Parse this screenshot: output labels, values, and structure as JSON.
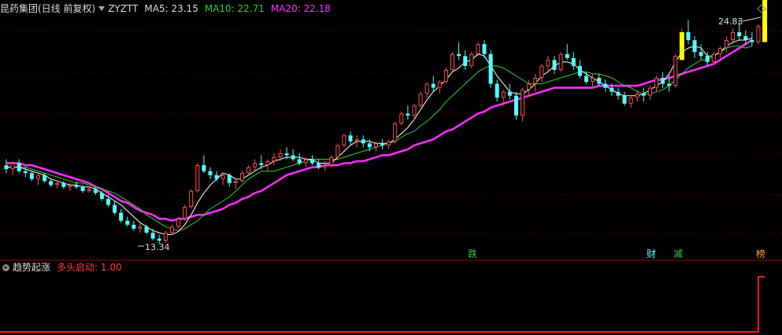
{
  "header": {
    "stock_name": "昆药集团(日线 前复权)",
    "indicator_name": "ZYZTT",
    "ma5_label": "MA5: 23.15",
    "ma10_label": "MA10: 22.71",
    "ma20_label": "MA20: 22.18"
  },
  "sub_header": {
    "indicator_name": "趋势起涨",
    "signal_label": "多头启动: 1.00"
  },
  "markers": {
    "high_label": "24.83",
    "low_label": "13.34",
    "signal_die": "跌",
    "signal_cai": "财",
    "signal_jian": "减",
    "signal_bang": "榜"
  },
  "colors": {
    "up": "#ff4d4d",
    "down": "#54ffff",
    "ma5": "#ffffff",
    "ma10": "#30d030",
    "ma20": "#ff2bff",
    "signal_bar": "#ffff00",
    "grid": "#7a0000",
    "signal_line": "#ff1a1a"
  },
  "chart_data": [
    {
      "type": "candlestick",
      "title": "昆药集团(日线 前复权)",
      "ohlc": [
        [
          17.3,
          17.6,
          16.9,
          17.1
        ],
        [
          17.1,
          17.5,
          16.8,
          17.4
        ],
        [
          17.4,
          17.6,
          16.9,
          17.0
        ],
        [
          17.0,
          17.2,
          16.7,
          16.9
        ],
        [
          16.9,
          17.0,
          16.5,
          16.6
        ],
        [
          16.6,
          16.9,
          16.3,
          16.8
        ],
        [
          16.8,
          16.9,
          16.4,
          16.5
        ],
        [
          16.5,
          16.6,
          16.2,
          16.3
        ],
        [
          16.3,
          16.5,
          16.1,
          16.4
        ],
        [
          16.4,
          16.5,
          16.1,
          16.2
        ],
        [
          16.2,
          16.4,
          16.0,
          16.3
        ],
        [
          16.3,
          16.5,
          16.1,
          16.2
        ],
        [
          16.2,
          16.3,
          15.9,
          16.0
        ],
        [
          16.0,
          16.2,
          15.9,
          16.1
        ],
        [
          16.1,
          16.2,
          15.8,
          15.9
        ],
        [
          15.9,
          16.0,
          15.5,
          15.6
        ],
        [
          15.6,
          15.8,
          15.2,
          15.3
        ],
        [
          15.3,
          15.5,
          14.8,
          14.9
        ],
        [
          14.9,
          15.1,
          14.4,
          14.5
        ],
        [
          14.5,
          14.7,
          14.2,
          14.3
        ],
        [
          14.3,
          14.5,
          14.0,
          14.1
        ],
        [
          14.1,
          14.4,
          13.9,
          14.2
        ],
        [
          14.2,
          14.3,
          13.8,
          13.9
        ],
        [
          13.9,
          14.1,
          13.5,
          13.6
        ],
        [
          13.6,
          13.8,
          13.34,
          13.5
        ],
        [
          13.5,
          14.0,
          13.4,
          13.9
        ],
        [
          13.9,
          14.3,
          13.8,
          14.2
        ],
        [
          14.2,
          14.7,
          14.1,
          14.6
        ],
        [
          14.6,
          15.3,
          14.5,
          15.2
        ],
        [
          15.2,
          16.1,
          15.1,
          16.0
        ],
        [
          16.0,
          17.4,
          15.9,
          17.3
        ],
        [
          17.3,
          17.8,
          16.9,
          17.0
        ],
        [
          17.0,
          17.2,
          16.6,
          16.8
        ],
        [
          16.8,
          17.0,
          16.5,
          16.6
        ],
        [
          16.6,
          16.9,
          16.3,
          16.8
        ],
        [
          16.8,
          16.9,
          16.2,
          16.4
        ],
        [
          16.4,
          16.6,
          16.1,
          16.5
        ],
        [
          16.5,
          17.0,
          16.4,
          16.9
        ],
        [
          16.9,
          17.3,
          16.8,
          17.2
        ],
        [
          17.2,
          17.6,
          17.0,
          17.4
        ],
        [
          17.4,
          17.8,
          17.1,
          17.3
        ],
        [
          17.3,
          17.6,
          17.0,
          17.5
        ],
        [
          17.5,
          17.9,
          17.3,
          17.7
        ],
        [
          17.7,
          18.1,
          17.5,
          17.9
        ],
        [
          17.9,
          18.2,
          17.6,
          17.8
        ],
        [
          17.8,
          18.1,
          17.5,
          17.6
        ],
        [
          17.6,
          17.9,
          17.3,
          17.4
        ],
        [
          17.4,
          17.7,
          17.2,
          17.6
        ],
        [
          17.6,
          17.8,
          17.3,
          17.4
        ],
        [
          17.4,
          17.6,
          17.1,
          17.2
        ],
        [
          17.2,
          17.5,
          17.0,
          17.3
        ],
        [
          17.3,
          17.8,
          17.2,
          17.7
        ],
        [
          17.7,
          18.4,
          17.6,
          18.3
        ],
        [
          18.3,
          18.9,
          18.2,
          18.8
        ],
        [
          18.8,
          19.0,
          18.3,
          18.5
        ],
        [
          18.5,
          18.8,
          18.2,
          18.6
        ],
        [
          18.6,
          18.8,
          18.2,
          18.4
        ],
        [
          18.4,
          18.6,
          18.0,
          18.2
        ],
        [
          18.2,
          18.5,
          18.0,
          18.4
        ],
        [
          18.4,
          18.6,
          18.1,
          18.3
        ],
        [
          18.3,
          18.6,
          18.1,
          18.5
        ],
        [
          18.5,
          19.5,
          18.4,
          19.4
        ],
        [
          19.4,
          20.0,
          19.3,
          19.9
        ],
        [
          19.9,
          20.3,
          19.6,
          19.8
        ],
        [
          19.8,
          20.4,
          19.6,
          20.3
        ],
        [
          20.3,
          21.0,
          20.2,
          20.9
        ],
        [
          20.9,
          21.5,
          20.7,
          21.4
        ],
        [
          21.4,
          21.8,
          21.0,
          21.2
        ],
        [
          21.2,
          21.6,
          20.9,
          21.5
        ],
        [
          21.5,
          22.2,
          21.4,
          22.1
        ],
        [
          22.1,
          23.0,
          22.0,
          22.9
        ],
        [
          22.9,
          23.5,
          22.6,
          22.8
        ],
        [
          22.8,
          23.1,
          22.1,
          22.3
        ],
        [
          22.3,
          23.0,
          22.2,
          22.9
        ],
        [
          22.9,
          23.5,
          22.8,
          23.4
        ],
        [
          23.4,
          23.6,
          22.7,
          22.9
        ],
        [
          22.9,
          23.1,
          21.2,
          21.4
        ],
        [
          21.4,
          21.6,
          20.5,
          20.7
        ],
        [
          20.7,
          21.1,
          20.3,
          21.0
        ],
        [
          21.0,
          21.4,
          20.6,
          20.8
        ],
        [
          20.8,
          21.0,
          19.6,
          19.8
        ],
        [
          19.8,
          21.2,
          19.5,
          21.1
        ],
        [
          21.1,
          21.6,
          20.8,
          21.4
        ],
        [
          21.4,
          21.9,
          21.0,
          21.7
        ],
        [
          21.7,
          22.4,
          21.5,
          22.3
        ],
        [
          22.3,
          22.8,
          22.0,
          22.6
        ],
        [
          22.6,
          22.8,
          21.9,
          22.1
        ],
        [
          22.1,
          23.0,
          22.0,
          22.9
        ],
        [
          22.9,
          23.4,
          22.6,
          22.7
        ],
        [
          22.7,
          23.0,
          22.1,
          22.3
        ],
        [
          22.3,
          22.6,
          21.7,
          21.8
        ],
        [
          21.8,
          22.0,
          21.4,
          21.5
        ],
        [
          21.5,
          21.9,
          21.2,
          21.7
        ],
        [
          21.7,
          21.9,
          21.3,
          21.4
        ],
        [
          21.4,
          21.6,
          21.0,
          21.2
        ],
        [
          21.2,
          21.4,
          20.8,
          21.0
        ],
        [
          21.0,
          21.2,
          20.6,
          20.8
        ],
        [
          20.8,
          21.0,
          20.3,
          20.4
        ],
        [
          20.4,
          20.8,
          20.2,
          20.7
        ],
        [
          20.7,
          21.1,
          20.5,
          20.9
        ],
        [
          20.9,
          21.2,
          20.5,
          20.8
        ],
        [
          20.8,
          21.3,
          20.6,
          21.2
        ],
        [
          21.2,
          21.8,
          21.0,
          21.7
        ],
        [
          21.7,
          22.0,
          21.2,
          21.4
        ],
        [
          21.4,
          21.9,
          21.0,
          21.3
        ],
        [
          21.3,
          22.9,
          21.2,
          22.8
        ],
        [
          22.8,
          24.2,
          22.6,
          24.0
        ],
        [
          24.0,
          24.6,
          23.4,
          23.6
        ],
        [
          23.6,
          23.8,
          22.7,
          23.0
        ],
        [
          23.0,
          23.4,
          22.6,
          22.8
        ],
        [
          22.8,
          23.0,
          22.3,
          22.5
        ],
        [
          22.5,
          23.0,
          22.4,
          22.9
        ],
        [
          22.9,
          23.3,
          22.6,
          23.2
        ],
        [
          23.2,
          23.8,
          23.0,
          23.6
        ],
        [
          23.6,
          24.2,
          23.4,
          24.0
        ],
        [
          24.0,
          24.6,
          23.6,
          23.8
        ],
        [
          23.8,
          24.1,
          23.4,
          23.6
        ],
        [
          23.6,
          24.0,
          23.3,
          23.5
        ],
        [
          23.5,
          24.4,
          23.4,
          24.3
        ]
      ],
      "ma5": [
        17.2,
        17.2,
        17.2,
        17.1,
        17.0,
        16.9,
        16.8,
        16.6,
        16.5,
        16.4,
        16.3,
        16.3,
        16.2,
        16.2,
        16.1,
        15.9,
        15.7,
        15.5,
        15.3,
        15.0,
        14.7,
        14.4,
        14.2,
        14.0,
        13.9,
        13.8,
        13.8,
        13.96,
        14.3,
        14.8,
        15.4,
        15.9,
        16.3,
        16.6,
        16.9,
        16.8,
        16.6,
        16.6,
        16.8,
        17.0,
        17.2,
        17.3,
        17.5,
        17.6,
        17.7,
        17.7,
        17.7,
        17.6,
        17.6,
        17.4,
        17.4,
        17.4,
        17.7,
        18.0,
        18.3,
        18.5,
        18.5,
        18.5,
        18.4,
        18.4,
        18.4,
        18.6,
        18.9,
        19.2,
        19.6,
        20.1,
        20.6,
        21.0,
        21.3,
        21.6,
        22.0,
        22.2,
        22.5,
        22.6,
        22.9,
        22.8,
        22.3,
        21.8,
        21.4,
        21.0,
        20.9,
        20.9,
        21.1,
        21.4,
        21.8,
        22.0,
        22.3,
        22.5,
        22.5,
        22.4,
        22.1,
        21.9,
        21.7,
        21.5,
        21.3,
        21.1,
        20.9,
        20.8,
        20.8,
        20.8,
        20.9,
        21.1,
        21.3,
        21.5,
        21.9,
        22.5,
        23.0,
        23.2,
        23.3,
        23.2,
        22.8,
        22.8,
        23.0,
        23.3,
        23.5,
        23.6,
        23.6,
        23.7
      ],
      "ma10": [
        17.2,
        17.2,
        17.2,
        17.2,
        17.1,
        17.0,
        16.9,
        16.8,
        16.7,
        16.6,
        16.5,
        16.4,
        16.4,
        16.3,
        16.2,
        16.1,
        16.0,
        15.9,
        15.7,
        15.5,
        15.3,
        15.1,
        14.8,
        14.6,
        14.4,
        14.2,
        14.1,
        14.0,
        14.1,
        14.3,
        14.5,
        14.8,
        15.1,
        15.3,
        15.5,
        15.7,
        16.0,
        16.3,
        16.6,
        16.8,
        17.0,
        17.0,
        17.0,
        17.1,
        17.2,
        17.3,
        17.4,
        17.5,
        17.6,
        17.6,
        17.6,
        17.6,
        17.6,
        17.7,
        17.8,
        17.9,
        18.0,
        18.1,
        18.2,
        18.3,
        18.4,
        18.5,
        18.7,
        18.9,
        19.0,
        19.3,
        19.5,
        19.8,
        20.1,
        20.5,
        20.8,
        21.1,
        21.4,
        21.7,
        22.0,
        22.2,
        22.3,
        22.3,
        22.2,
        22.0,
        21.8,
        21.6,
        21.4,
        21.4,
        21.4,
        21.5,
        21.6,
        21.7,
        21.8,
        21.9,
        22.0,
        22.0,
        21.9,
        21.9,
        21.8,
        21.7,
        21.5,
        21.3,
        21.2,
        21.0,
        20.9,
        20.9,
        21.0,
        21.1,
        21.3,
        21.6,
        21.9,
        22.2,
        22.4,
        22.6,
        22.6,
        22.8,
        23.0,
        23.2,
        23.3,
        23.3,
        23.2,
        23.3
      ],
      "ma20": [
        17.4,
        17.4,
        17.4,
        17.3,
        17.3,
        17.2,
        17.1,
        17.0,
        16.9,
        16.8,
        16.7,
        16.6,
        16.5,
        16.4,
        16.2,
        16.1,
        15.9,
        15.7,
        15.5,
        15.4,
        15.2,
        15.0,
        14.9,
        14.8,
        14.6,
        14.6,
        14.5,
        14.6,
        14.6,
        14.7,
        14.8,
        14.8,
        14.9,
        15.0,
        15.1,
        15.3,
        15.4,
        15.6,
        15.7,
        15.9,
        16.0,
        16.2,
        16.4,
        16.6,
        16.8,
        16.9,
        17.0,
        17.1,
        17.2,
        17.2,
        17.3,
        17.3,
        17.3,
        17.4,
        17.4,
        17.5,
        17.5,
        17.6,
        17.7,
        17.8,
        17.8,
        17.9,
        18.0,
        18.1,
        18.3,
        18.4,
        18.5,
        18.6,
        18.8,
        19.0,
        19.1,
        19.3,
        19.5,
        19.7,
        19.9,
        20.0,
        20.2,
        20.3,
        20.4,
        20.5,
        20.6,
        20.7,
        20.8,
        20.9,
        21.0,
        21.1,
        21.2,
        21.2,
        21.2,
        21.2,
        21.2,
        21.2,
        21.2,
        21.3,
        21.3,
        21.3,
        21.3,
        21.3,
        21.3,
        21.3,
        21.4,
        21.5,
        21.6,
        21.6,
        21.7,
        21.8,
        21.9,
        22.0,
        22.1,
        22.2,
        22.3,
        22.4,
        22.6,
        22.8,
        23.0,
        23.2,
        23.4,
        23.6
      ],
      "signal_bars": [
        {
          "index": 106,
          "low": 22.6,
          "high": 24.0
        },
        {
          "index": 119,
          "low": 23.5,
          "high": 25.8
        }
      ],
      "high": 24.83,
      "low": 13.34
    },
    {
      "type": "line",
      "title": "趋势起涨",
      "series": [
        {
          "name": "多头启动",
          "values": [
            0,
            0,
            0,
            0,
            0,
            0,
            0,
            0,
            0,
            0,
            0,
            0,
            0,
            0,
            0,
            0,
            0,
            0,
            0,
            0,
            0,
            0,
            0,
            0,
            0,
            0,
            0,
            0,
            0,
            0,
            0,
            0,
            0,
            0,
            0,
            0,
            0,
            0,
            0,
            0,
            0,
            0,
            0,
            0,
            0,
            0,
            0,
            0,
            0,
            0,
            0,
            0,
            0,
            0,
            0,
            0,
            0,
            0,
            0,
            0,
            0,
            0,
            0,
            0,
            0,
            0,
            0,
            0,
            0,
            0,
            0,
            0,
            0,
            0,
            0,
            0,
            0,
            0,
            0,
            0,
            0,
            0,
            0,
            0,
            0,
            0,
            0,
            0,
            0,
            0,
            0,
            0,
            0,
            0,
            0,
            0,
            0,
            0,
            0,
            0,
            0,
            0,
            0,
            0,
            0,
            0,
            0,
            0,
            0,
            0,
            0,
            0,
            0,
            0,
            0,
            0,
            0,
            0,
            0,
            1
          ]
        }
      ],
      "ylim": [
        0,
        1
      ]
    }
  ]
}
